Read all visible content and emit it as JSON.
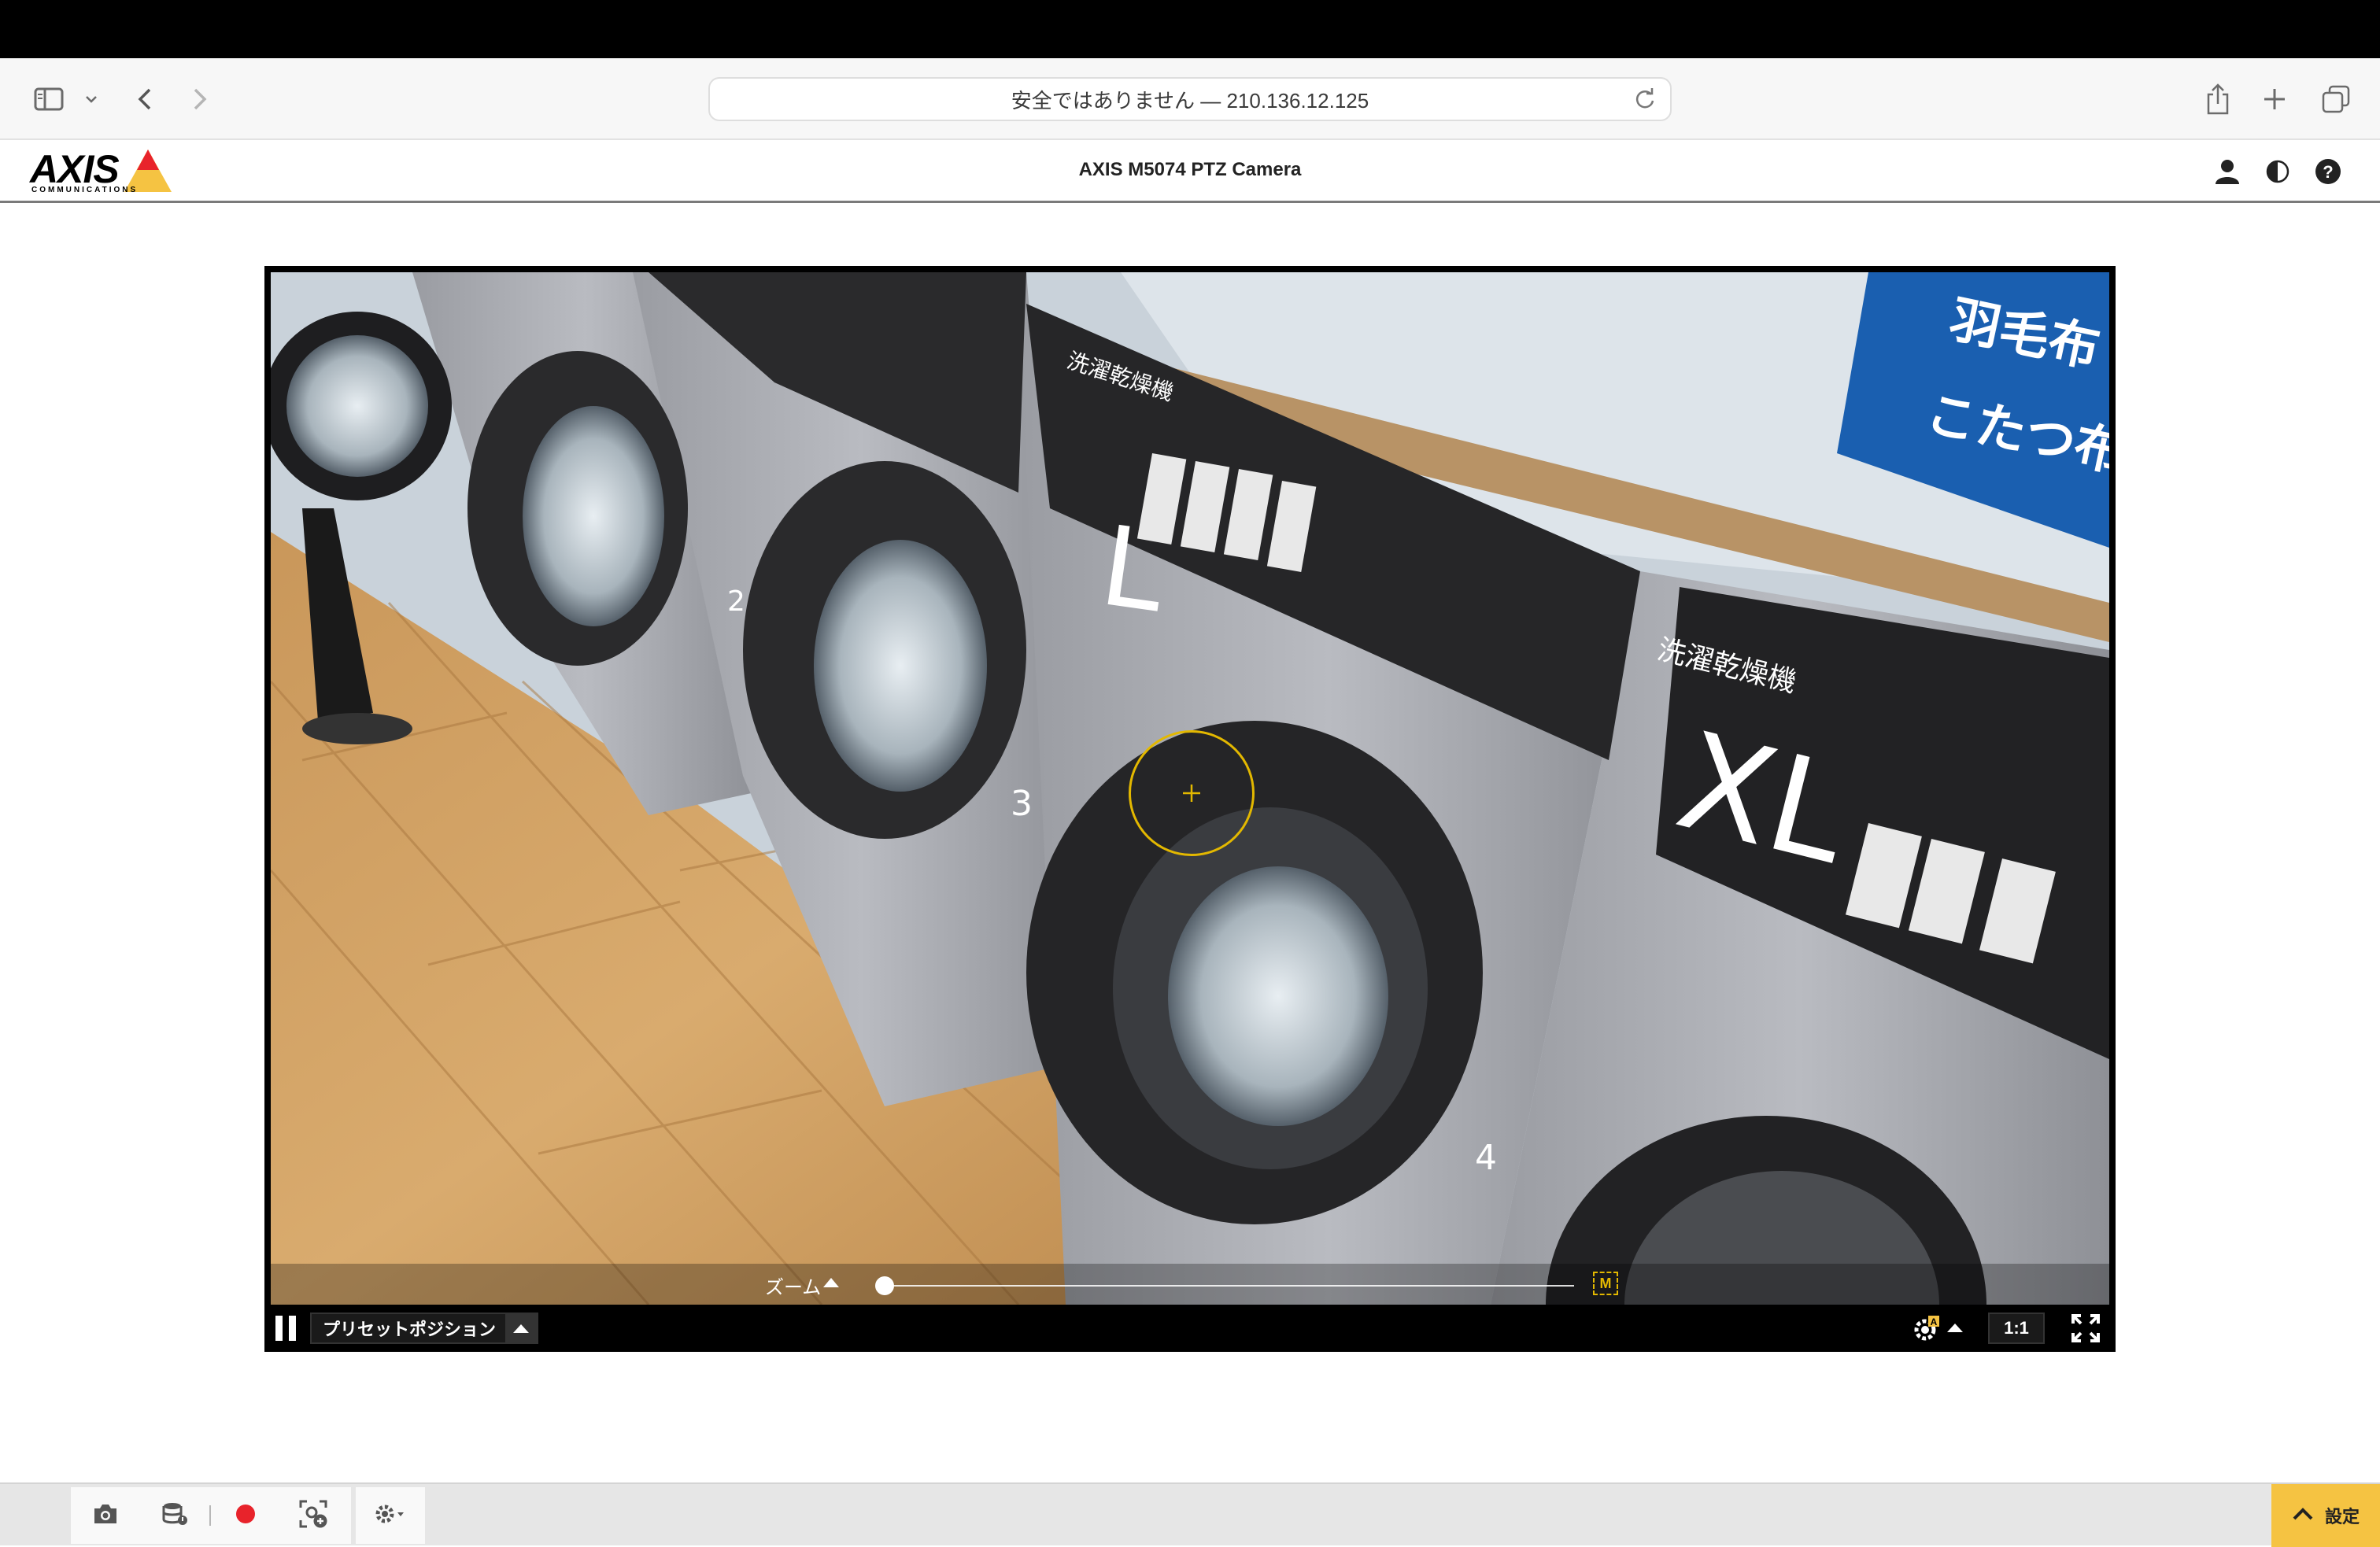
{
  "browser": {
    "address": "安全ではありません — 210.136.12.125"
  },
  "app": {
    "brand": "AXIS",
    "brand_sub": "COMMUNICATIONS",
    "title": "AXIS M5074 PTZ Camera"
  },
  "video": {
    "zoom_label": "ズーム",
    "zoom_level": 0.0,
    "zoom_mode_badge": "M",
    "preset_label": "プリセットポジション",
    "ratio_label": "1:1"
  },
  "toolbar": {
    "settings_label": "設定",
    "record_color": "#e8232b"
  },
  "colors": {
    "accent_yellow": "#f5c342",
    "ptz_marker": "#e3b800"
  },
  "icons": [
    "sidebar-icon",
    "chevron-down-icon",
    "back-icon",
    "forward-icon",
    "reload-icon",
    "share-icon",
    "new-tab-icon",
    "tabs-icon",
    "user-icon",
    "contrast-icon",
    "help-icon",
    "pause-icon",
    "gear-auto-icon",
    "fullscreen-icon",
    "camera-icon",
    "storage-icon",
    "record-icon",
    "ptz-add-icon",
    "gear-icon",
    "chevron-up-icon"
  ]
}
